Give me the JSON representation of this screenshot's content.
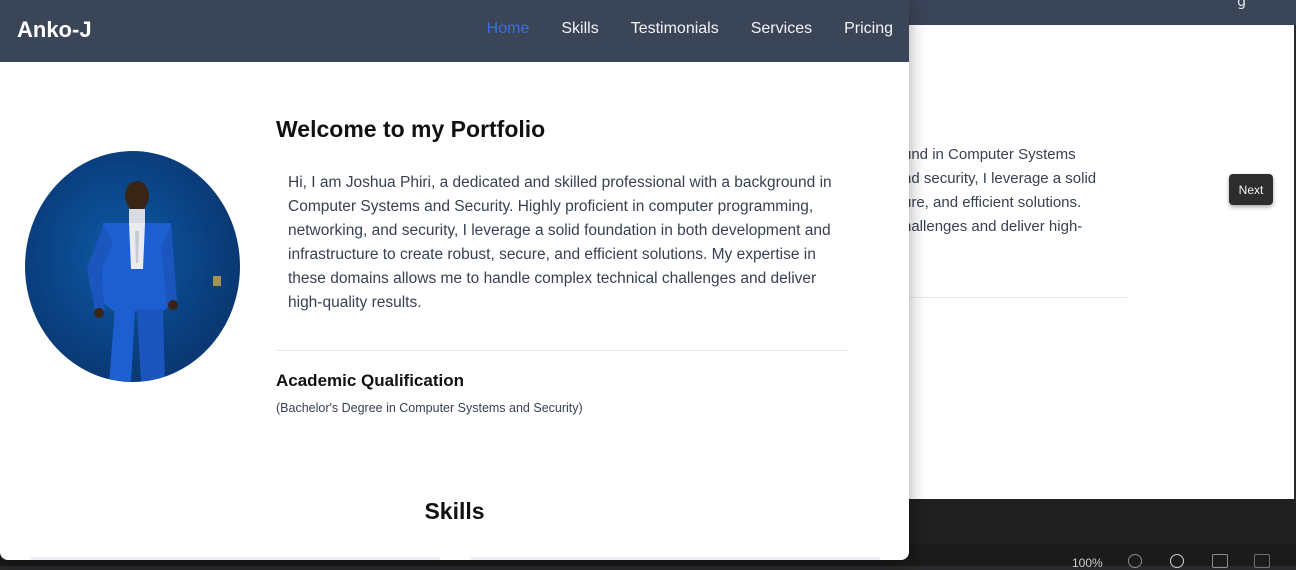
{
  "background_window": {
    "partial_text": "und in Computer Systems\nnd security, I leverage a solid\nure, and efficient solutions.\nhallenges and deliver high-",
    "next_button": "Next",
    "zoom_level": "100%"
  },
  "nav": {
    "brand": "Anko-J",
    "links": [
      {
        "label": "Home",
        "active": true
      },
      {
        "label": "Skills",
        "active": false
      },
      {
        "label": "Testimonials",
        "active": false
      },
      {
        "label": "Services",
        "active": false
      },
      {
        "label": "Pricing",
        "active": false
      }
    ]
  },
  "hero": {
    "title": "Welcome to my Portfolio",
    "intro": "Hi, I am Joshua Phiri, a dedicated and skilled professional with a background in Computer Systems and Security. Highly proficient in computer programming, networking, and security, I leverage a solid foundation in both development and infrastructure to create robust, secure, and efficient solutions. My expertise in these domains allows me to handle complex technical challenges and deliver high-quality results."
  },
  "qualification": {
    "title": "Academic Qualification",
    "detail": "(Bachelor's Degree in Computer Systems and Security)"
  },
  "skills": {
    "title": "Skills"
  },
  "colors": {
    "nav_bg": "#3b4558",
    "active_link": "#3b6fe0",
    "portrait_bg": "#0a3f7f",
    "suit_blue": "#1d5fd1"
  }
}
